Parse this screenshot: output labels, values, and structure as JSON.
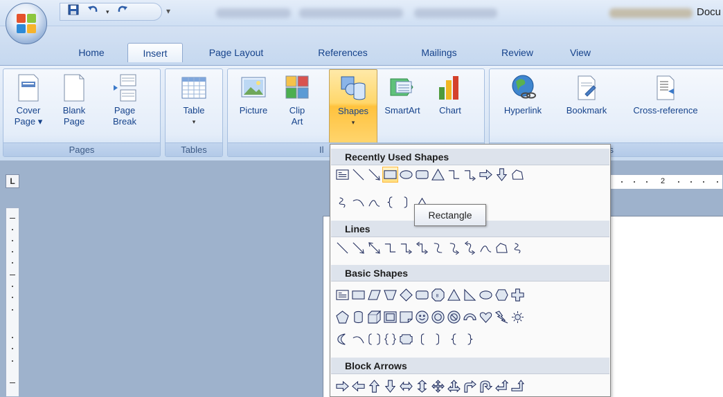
{
  "title_bar": {
    "doc_title": "Docu",
    "qat": {
      "save_icon": "save-icon",
      "undo_icon": "undo-icon",
      "redo_icon": "redo-icon",
      "more_icon": "customize-arrow-icon"
    }
  },
  "tabs": [
    {
      "label": "Home"
    },
    {
      "label": "Insert"
    },
    {
      "label": "Page Layout"
    },
    {
      "label": "References"
    },
    {
      "label": "Mailings"
    },
    {
      "label": "Review"
    },
    {
      "label": "View"
    }
  ],
  "active_tab": "Insert",
  "ribbon": {
    "groups": [
      {
        "label": "Pages"
      },
      {
        "label": "Tables"
      },
      {
        "label": "Il"
      },
      {
        "label": "ks"
      }
    ],
    "buttons": {
      "cover_page": {
        "line1": "Cover",
        "line2": "Page ▾"
      },
      "blank_page": {
        "line1": "Blank",
        "line2": "Page"
      },
      "page_break": {
        "line1": "Page",
        "line2": "Break"
      },
      "table": {
        "line1": "Table",
        "line2": "▾"
      },
      "picture": {
        "line1": "Picture"
      },
      "clip_art": {
        "line1": "Clip",
        "line2": "Art"
      },
      "shapes": {
        "line1": "Shapes",
        "line2": "▾"
      },
      "smartart": {
        "line1": "SmartArt"
      },
      "chart": {
        "line1": "Chart"
      },
      "hyperlink": {
        "line1": "Hyperlink"
      },
      "bookmark": {
        "line1": "Bookmark"
      },
      "cross_reference": {
        "line1": "Cross-reference"
      }
    }
  },
  "ruler": {
    "corner": "L",
    "number": "2"
  },
  "shapes_menu": {
    "sections": [
      {
        "title": "Recently Used Shapes"
      },
      {
        "title": "Lines"
      },
      {
        "title": "Basic Shapes"
      },
      {
        "title": "Block Arrows"
      }
    ],
    "tooltip": "Rectangle"
  }
}
